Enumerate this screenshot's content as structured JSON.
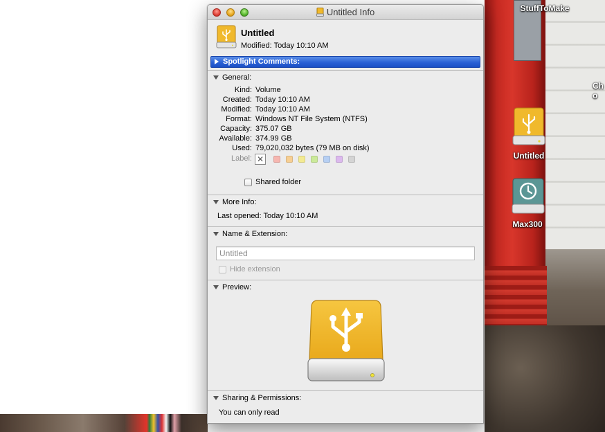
{
  "window": {
    "title": "Untitled Info",
    "controls": [
      "close",
      "minimize",
      "zoom"
    ]
  },
  "header": {
    "name": "Untitled",
    "modified_label": "Modified:",
    "modified_value": "Today 10:10 AM"
  },
  "spotlight": {
    "label": "Spotlight Comments:"
  },
  "general": {
    "label": "General:",
    "rows": [
      {
        "key": "Kind:",
        "value": "Volume"
      },
      {
        "key": "Created:",
        "value": "Today 10:10 AM"
      },
      {
        "key": "Modified:",
        "value": "Today 10:10 AM"
      },
      {
        "key": "Format:",
        "value": "Windows NT File System (NTFS)"
      },
      {
        "key": "Capacity:",
        "value": "375.07 GB"
      },
      {
        "key": "Available:",
        "value": "374.99 GB"
      },
      {
        "key": "Used:",
        "value": "79,020,032 bytes (79 MB on disk)"
      }
    ],
    "label_key": "Label:",
    "label_colors": [
      "#f6b6b0",
      "#f7cf93",
      "#f3ea92",
      "#cbea9a",
      "#b6cff3",
      "#dcb9ee",
      "#d4d4d4"
    ],
    "shared_folder": "Shared folder"
  },
  "more_info": {
    "label": "More Info:",
    "last_opened_label": "Last opened:",
    "last_opened_value": "Today 10:10 AM"
  },
  "name_ext": {
    "label": "Name & Extension:",
    "name_value": "Untitled",
    "hide_extension": "Hide extension"
  },
  "preview": {
    "label": "Preview:"
  },
  "sharing": {
    "label": "Sharing & Permissions:",
    "status": "You can only read"
  },
  "desktop": {
    "items": [
      {
        "label": "StuffToMake"
      },
      {
        "label": "Ch\no"
      },
      {
        "label": "Untitled"
      },
      {
        "label": "Max300"
      }
    ]
  },
  "colors": {
    "drive_gold": "#f0b92c",
    "spotlight_blue": "#2a60d5",
    "timemachine_teal": "#5b9695"
  }
}
